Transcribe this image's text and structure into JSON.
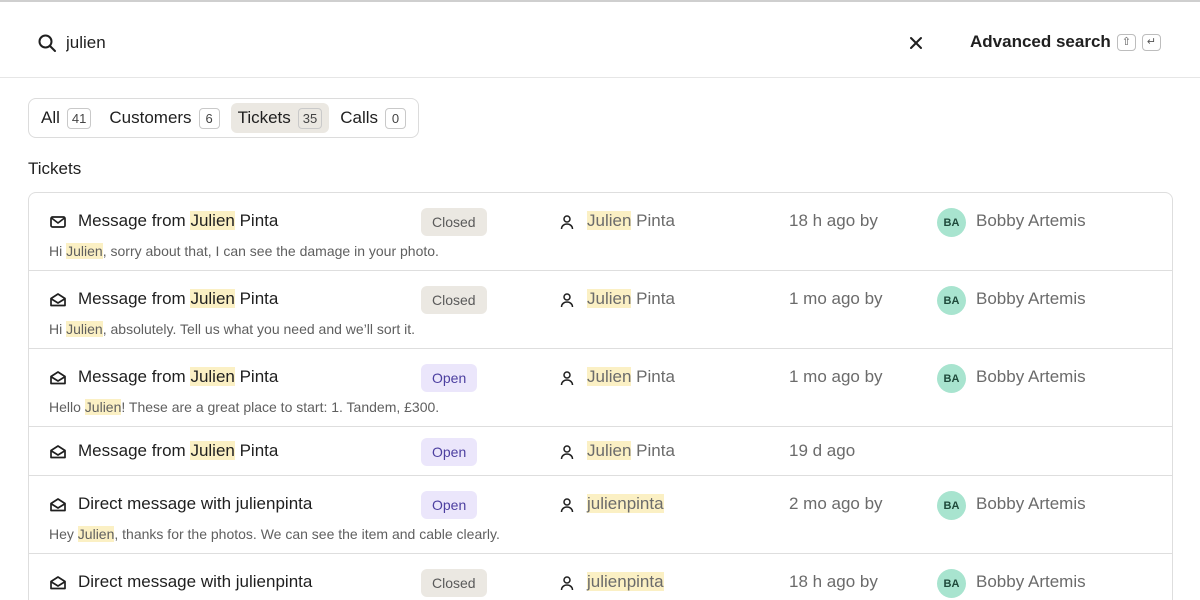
{
  "search": {
    "query": "julien",
    "placeholder": ""
  },
  "header": {
    "advanced_label": "Advanced search",
    "shortcut_shift": "⇧",
    "shortcut_enter": "↵"
  },
  "filters": [
    {
      "label": "All",
      "count": "41"
    },
    {
      "label": "Customers",
      "count": "6"
    },
    {
      "label": "Tickets",
      "count": "35"
    },
    {
      "label": "Calls",
      "count": "0"
    }
  ],
  "section_title": "Tickets",
  "tickets": [
    {
      "icon": "mail-closed-icon",
      "title_pre": "Message from ",
      "title_hl": "Julien",
      "title_post": " Pinta",
      "status": "Closed",
      "customer_hl": "Julien",
      "customer_post": " Pinta",
      "time": "18 h ago by",
      "avatar": "BA",
      "agent": "Bobby Artemis",
      "snippet_pre": "Hi ",
      "snippet_hl": "Julien",
      "snippet_post": ", sorry about that, I can see the damage in your photo."
    },
    {
      "icon": "mail-open-icon",
      "title_pre": "Message from ",
      "title_hl": "Julien",
      "title_post": " Pinta",
      "status": "Closed",
      "customer_hl": "Julien",
      "customer_post": " Pinta",
      "time": "1 mo ago by",
      "avatar": "BA",
      "agent": "Bobby Artemis",
      "snippet_pre": "Hi ",
      "snippet_hl": "Julien",
      "snippet_post": ", absolutely. Tell us what you need and we’ll sort it."
    },
    {
      "icon": "mail-open-icon",
      "title_pre": "Message from ",
      "title_hl": "Julien",
      "title_post": " Pinta",
      "status": "Open",
      "customer_hl": "Julien",
      "customer_post": " Pinta",
      "time": "1 mo ago by",
      "avatar": "BA",
      "agent": "Bobby Artemis",
      "snippet_pre": "Hello ",
      "snippet_hl": "Julien",
      "snippet_post": "! These are a great place to start: 1. Tandem, £300."
    },
    {
      "icon": "mail-open-icon",
      "title_pre": "Message from ",
      "title_hl": "Julien",
      "title_post": " Pinta",
      "status": "Open",
      "customer_hl": "Julien",
      "customer_post": " Pinta",
      "time": "19 d ago"
    },
    {
      "icon": "mail-open-icon",
      "title_pre": "Direct message with julienpinta",
      "title_hl": "",
      "title_post": "",
      "status": "Open",
      "customer_hl": "julienpinta",
      "customer_post": "",
      "time": "2 mo ago by",
      "avatar": "BA",
      "agent": "Bobby Artemis",
      "snippet_pre": "Hey ",
      "snippet_hl": "Julien",
      "snippet_post": ", thanks for the photos. We can see the item and cable clearly."
    },
    {
      "icon": "mail-open-icon",
      "title_pre": "Direct message with julienpinta",
      "title_hl": "",
      "title_post": "",
      "status": "Closed",
      "customer_hl": "julienpinta",
      "customer_post": "",
      "time": "18 h ago by",
      "avatar": "BA",
      "agent": "Bobby Artemis"
    }
  ],
  "colors": {
    "highlight": "#fbf0c4",
    "open_badge": "#ebe6fb",
    "closed_badge": "#ebe8e2",
    "avatar": "#a8e4cf"
  }
}
